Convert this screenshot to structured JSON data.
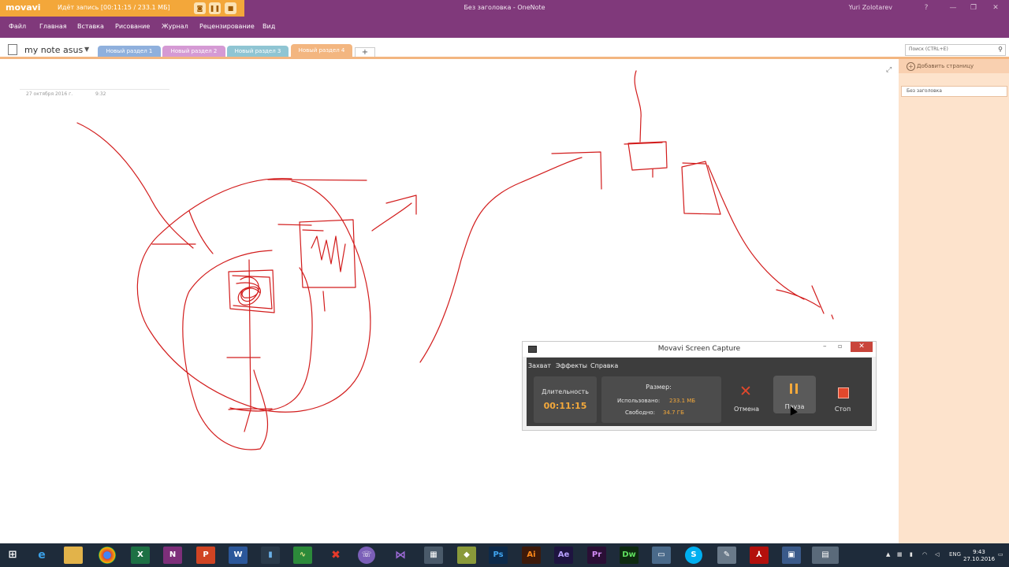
{
  "window": {
    "doc_title": "Без заголовка  -  OneNote",
    "user": "Yuri Zolotarev",
    "controls": [
      "?",
      "—",
      "❐",
      "✕"
    ]
  },
  "movavi_bar": {
    "logo": "movavi",
    "status": "Идёт запись   [00:11:15 / 233.1 МБ]"
  },
  "menu": [
    "Файл",
    "Главная",
    "Вставка",
    "Рисование",
    "Журнал",
    "Рецензирование",
    "Вид"
  ],
  "notebook": {
    "name": "my note asus"
  },
  "tabs": [
    {
      "label": "Новый раздел 1",
      "color": "#8fb0dd"
    },
    {
      "label": "Новый раздел 2",
      "color": "#d59ad4"
    },
    {
      "label": "Новый раздел 3",
      "color": "#8fc5d3"
    },
    {
      "label": "Новый раздел 4",
      "color": "#f3b680"
    }
  ],
  "add_tab_label": "+",
  "search": {
    "placeholder": "Поиск (CTRL+E)"
  },
  "page_pane": {
    "add_page": "Добавить страницу",
    "pages": [
      "Без заголовка"
    ]
  },
  "page": {
    "date": "27 октября 2016 г.",
    "time": "9:32"
  },
  "capture_window": {
    "title": "Movavi Screen Capture",
    "menu": [
      "Захват",
      "Эффекты",
      "Справка"
    ],
    "duration_label": "Длительность",
    "duration_value": "00:11:15",
    "size_label": "Размер:",
    "used_label": "Использовано:",
    "used_value": "233.1 МБ",
    "free_label": "Свободно:",
    "free_value": "34.7 ГБ",
    "cancel": "Отмена",
    "pause": "Пауза",
    "stop": "Стоп"
  },
  "taskbar": {
    "apps": [
      "windows-start",
      "internet-explorer",
      "file-explorer",
      "chrome",
      "excel",
      "onenote",
      "powerpoint",
      "word",
      "chart-app",
      "green-app",
      "xmind",
      "viber",
      "visual-studio",
      "network-app",
      "gpu-app",
      "photoshop",
      "illustrator",
      "after-effects",
      "premiere",
      "dreamweaver",
      "remote-desktop",
      "skype",
      "tool-app",
      "acrobat",
      "screen-app",
      "movavi-capture"
    ],
    "language": "ENG",
    "time": "9:43",
    "date": "27.10.2016"
  },
  "colors": {
    "accent": "#80397b",
    "ink": "#d21c1c",
    "movavi": "#f3a73a"
  }
}
